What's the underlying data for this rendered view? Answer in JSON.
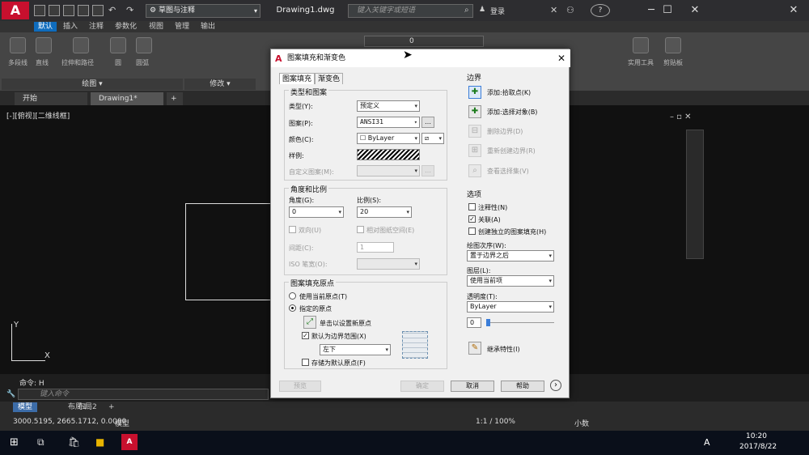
{
  "app": {
    "logo": "A",
    "workspace": "草图与注释",
    "document_title": "Drawing1.dwg",
    "search_placeholder": "键入关键字或短语",
    "login": "登录",
    "help": "?"
  },
  "ribbon": {
    "tabs": [
      "默认",
      "插入",
      "注释",
      "参数化",
      "视图",
      "管理",
      "输出"
    ],
    "panels": [
      "绘图 ▾",
      "修改 ▾"
    ],
    "tools": [
      "多段线",
      "直线",
      "拉伸和路径",
      "圆",
      "圆弧",
      "实用工具",
      "剪贴板"
    ],
    "layer_value": "0"
  },
  "doc_tabs": [
    "开始",
    "Drawing1*",
    "+"
  ],
  "viewport_label": "[-][俯视][二维线框]",
  "ucs": {
    "y": "Y",
    "x": "X"
  },
  "command": {
    "history": "命令: H",
    "placeholder": "键入命令"
  },
  "layout_tabs": [
    "模型",
    "布局1",
    "布局2",
    "+"
  ],
  "status": {
    "coords": "3000.5195, 2665.1712, 0.0000",
    "model": "模型",
    "scale": "1:1 / 100%",
    "units": "小数"
  },
  "taskbar": {
    "time": "10:20",
    "date": "2017/8/22",
    "ime": "A"
  },
  "dialog": {
    "title": "图案填充和渐变色",
    "close": "✕",
    "tabs": [
      "图案填充",
      "渐变色"
    ],
    "type_group": {
      "title": "类型和图案",
      "type_label": "类型(Y):",
      "type_value": "预定义",
      "pattern_label": "图案(P):",
      "pattern_value": "ANSI31",
      "color_label": "颜色(C):",
      "color_value": "ByLayer",
      "sample_label": "样例:",
      "custom_label": "自定义图案(M):"
    },
    "angle_group": {
      "title": "角度和比例",
      "angle_label": "角度(G):",
      "angle_value": "0",
      "scale_label": "比例(S):",
      "scale_value": "20",
      "double_label": "双向(U)",
      "relative_label": "相对图纸空间(E)",
      "spacing_label": "间距(C):",
      "spacing_value": "1",
      "iso_label": "ISO 笔宽(O):"
    },
    "origin_group": {
      "title": "图案填充原点",
      "use_current": "使用当前原点(T)",
      "specified": "指定的原点",
      "click_set": "单击以设置新原点",
      "default_extent": "默认为边界范围(X)",
      "extent_value": "左下",
      "store_default": "存储为默认原点(F)"
    },
    "boundary": {
      "title": "边界",
      "add_pick": "添加:拾取点(K)",
      "add_select": "添加:选择对象(B)",
      "remove": "删除边界(D)",
      "recreate": "重新创建边界(R)",
      "view_sel": "查看选择集(V)"
    },
    "options": {
      "title": "选项",
      "annotative": "注释性(N)",
      "associative": "关联(A)",
      "separate": "创建独立的图案填充(H)",
      "draw_order_label": "绘图次序(W):",
      "draw_order_value": "置于边界之后",
      "layer_label": "图层(L):",
      "layer_value": "使用当前项",
      "transparency_label": "透明度(T):",
      "transparency_value": "ByLayer",
      "transparency_num": "0"
    },
    "inherit": "继承特性(I)",
    "buttons": {
      "preview": "预览",
      "ok": "确定",
      "cancel": "取消",
      "help": "帮助",
      "more": "›"
    }
  }
}
